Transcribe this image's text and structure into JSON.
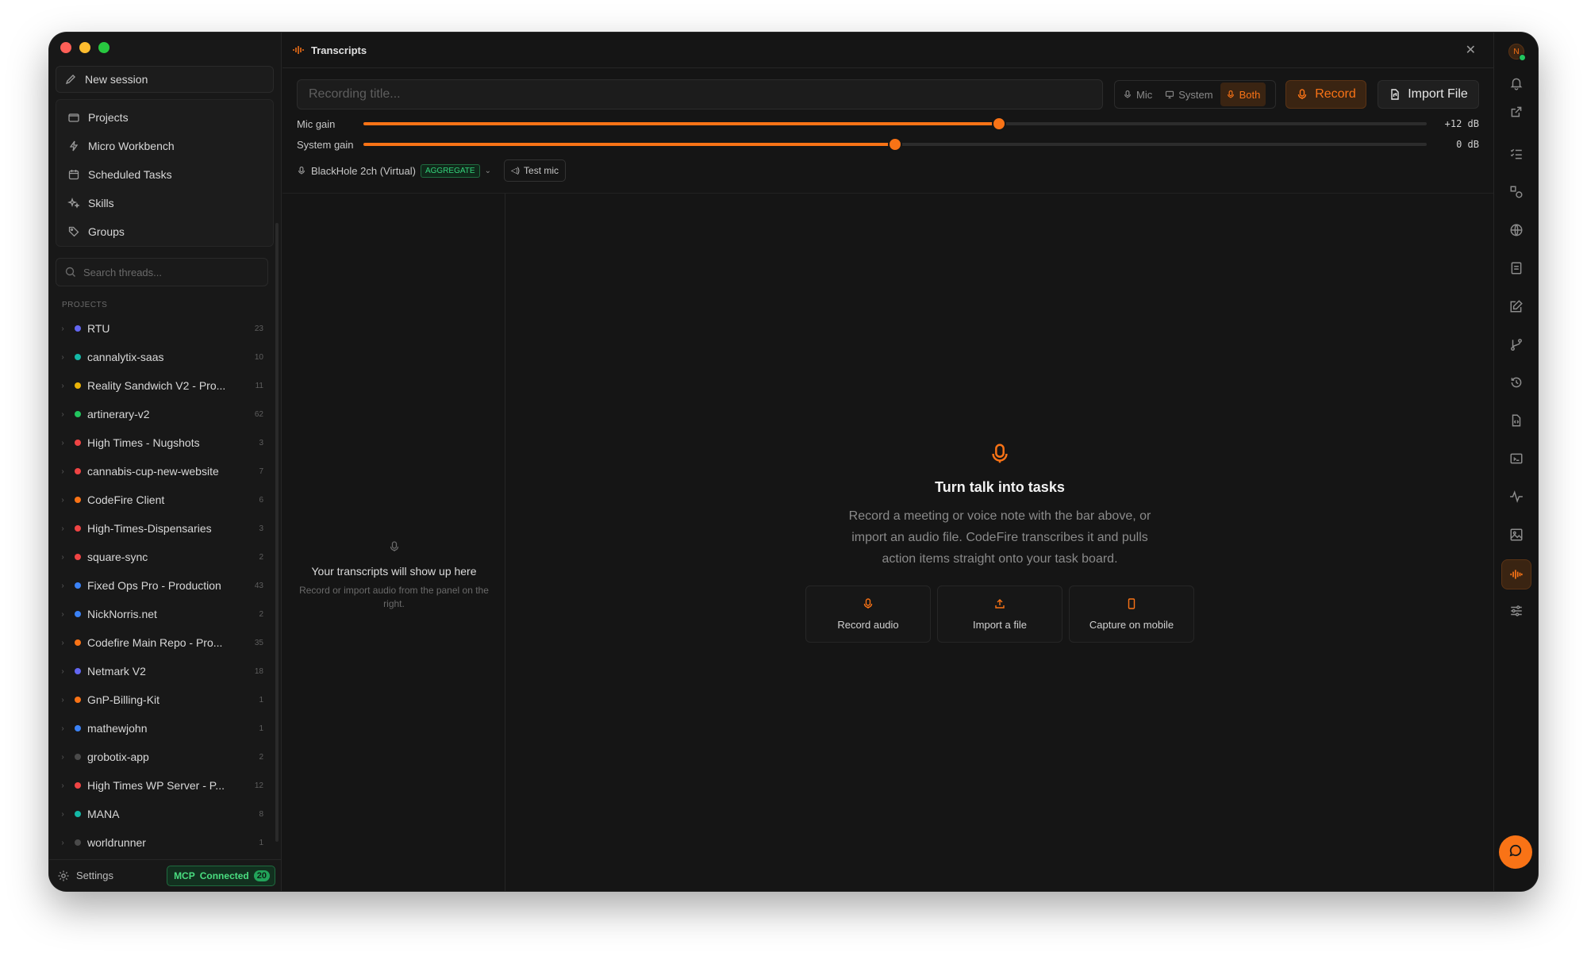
{
  "sidebar": {
    "new_session": "New session",
    "nav": [
      {
        "label": "Projects",
        "icon": "folder-icon"
      },
      {
        "label": "Micro Workbench",
        "icon": "bolt-icon"
      },
      {
        "label": "Scheduled Tasks",
        "icon": "calendar-icon"
      },
      {
        "label": "Skills",
        "icon": "sparkles-icon"
      },
      {
        "label": "Groups",
        "icon": "tag-icon"
      }
    ],
    "search_placeholder": "Search threads...",
    "section_label": "PROJECTS",
    "projects": [
      {
        "name": "RTU",
        "count": "23",
        "color": "#6366f1"
      },
      {
        "name": "cannalytix-saas",
        "count": "10",
        "color": "#14b8a6"
      },
      {
        "name": "Reality Sandwich V2 - Pro...",
        "count": "11",
        "color": "#eab308"
      },
      {
        "name": "artinerary-v2",
        "count": "62",
        "color": "#22c55e"
      },
      {
        "name": "High Times - Nugshots",
        "count": "3",
        "color": "#ef4444"
      },
      {
        "name": "cannabis-cup-new-website",
        "count": "7",
        "color": "#ef4444"
      },
      {
        "name": "CodeFire Client",
        "count": "6",
        "color": "#f97316"
      },
      {
        "name": "High-Times-Dispensaries",
        "count": "3",
        "color": "#ef4444"
      },
      {
        "name": "square-sync",
        "count": "2",
        "color": "#ef4444"
      },
      {
        "name": "Fixed Ops Pro - Production",
        "count": "43",
        "color": "#3b82f6"
      },
      {
        "name": "NickNorris.net",
        "count": "2",
        "color": "#3b82f6"
      },
      {
        "name": "Codefire Main Repo - Pro...",
        "count": "35",
        "color": "#f97316"
      },
      {
        "name": "Netmark V2",
        "count": "18",
        "color": "#6366f1"
      },
      {
        "name": "GnP-Billing-Kit",
        "count": "1",
        "color": "#f97316"
      },
      {
        "name": "mathewjohn",
        "count": "1",
        "color": "#3b82f6"
      },
      {
        "name": "grobotix-app",
        "count": "2",
        "color": "#4a4a4a"
      },
      {
        "name": "High Times WP Server - P...",
        "count": "12",
        "color": "#ef4444"
      },
      {
        "name": "MANA",
        "count": "8",
        "color": "#14b8a6"
      },
      {
        "name": "worldrunner",
        "count": "1",
        "color": "#4a4a4a"
      }
    ],
    "settings": "Settings",
    "mcp_label": "MCP",
    "mcp_status": "Connected",
    "mcp_count": "20"
  },
  "main": {
    "tab_title": "Transcripts",
    "title_placeholder": "Recording title...",
    "sources": [
      "Mic",
      "System",
      "Both"
    ],
    "active_source": "Both",
    "record_label": "Record",
    "import_label": "Import File",
    "mic_gain_label": "Mic gain",
    "mic_gain_value": "+12 dB",
    "mic_gain_level": 0.598,
    "system_gain_label": "System gain",
    "system_gain_value": "0 dB",
    "system_gain_level": 0.5,
    "device_name": "BlackHole 2ch (Virtual)",
    "device_badge": "AGGREGATE",
    "test_mic_label": "Test mic",
    "empty_list_title": "Your transcripts will show up here",
    "empty_list_sub": "Record or import audio from the panel on the right.",
    "hero_title": "Turn talk into tasks",
    "hero_desc_1": "Record a meeting or voice note with the bar above, or",
    "hero_desc_2": "import an audio file. CodeFire transcribes it and pulls",
    "hero_desc_3": "action items straight onto your task board.",
    "cards": [
      "Record audio",
      "Import a file",
      "Capture on mobile"
    ]
  },
  "rail": {
    "avatar_initial": "N",
    "accent": "#f97316"
  }
}
